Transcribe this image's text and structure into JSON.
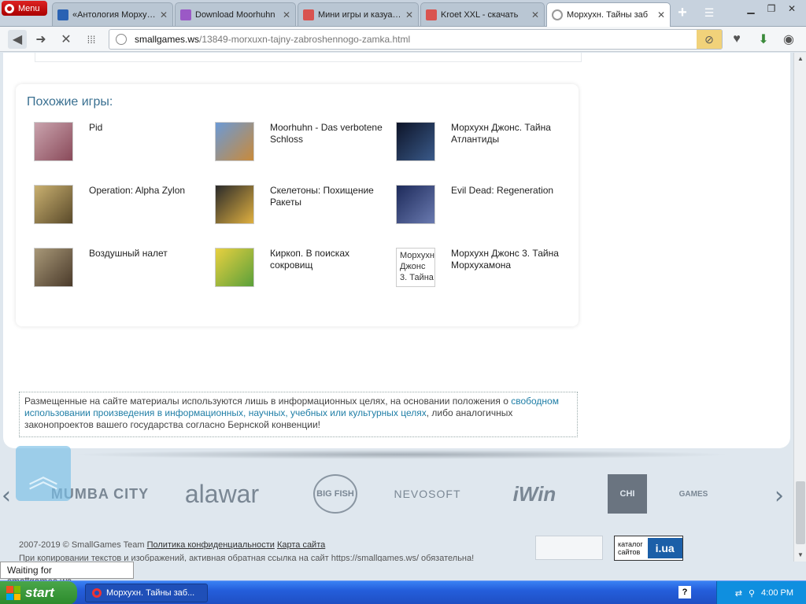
{
  "browser": {
    "menu_label": "Menu",
    "tabs": [
      {
        "title": "«Антология Морхухн»",
        "favicon_color": "#2a62b3"
      },
      {
        "title": "Download Moorhuhn",
        "favicon_color": "#9b59c6"
      },
      {
        "title": "Мини игры и казуаль",
        "favicon_color": "#d9534f"
      },
      {
        "title": "Kroet XXL - скачать",
        "favicon_color": "#d9534f"
      },
      {
        "title": "Морхухн. Тайны заб",
        "favicon_color": "#ffffff",
        "active": true
      }
    ],
    "url_domain": "smallgames.ws",
    "url_path": "/13849-morxuxn-tajny-zabroshennogo-zamka.html",
    "status_text": "Waiting for smallgames.ws..."
  },
  "similar_games": {
    "title": "Похожие игры:",
    "items": [
      {
        "name": "Pid",
        "thumb_color": "#8a4a5a"
      },
      {
        "name": "Moorhuhn - Das verbotene Schloss",
        "thumb_color": "#3c5f9a"
      },
      {
        "name": "Морхухн Джонс. Тайна Атлантиды",
        "thumb_color": "#1d2a4a"
      },
      {
        "name": "Operation: Alpha Zylon",
        "thumb_color": "#8a7440"
      },
      {
        "name": "Скелетоны: Похищение Ракеты",
        "thumb_color": "#3d8f3a"
      },
      {
        "name": "Evil Dead: Regeneration",
        "thumb_color": "#3a4a7a"
      },
      {
        "name": "Воздушный налет",
        "thumb_color": "#6a5a40"
      },
      {
        "name": "Киркоп. В поисках сокровищ",
        "thumb_color": "#7fbf3a"
      },
      {
        "name": "Морхухн Джонс 3. Тайна Морхухамона",
        "thumb_color": "#ffffff",
        "alt_text": "Морхухн Джонс 3. Тайна"
      }
    ]
  },
  "disclaimer": {
    "text_before": "Размещенные на сайте материалы используются лишь в информационных целях, на основании положения о ",
    "link_text": "свободном использовании произведения в информационных, научных, учебных или культурных целях",
    "text_after": ", либо аналогичных законопроектов вашего государства согласно Бернской конвенции!"
  },
  "partners": {
    "logos": [
      "MUMBA CITY",
      "alawar",
      "BIG FISH",
      "NEVOSOFT",
      "iWin",
      "CHI",
      "GAMES"
    ]
  },
  "footer": {
    "copyright": "2007-2019 © SmallGames Team",
    "privacy_link": "Политика конфиденциальности",
    "sitemap_link": "Карта сайта",
    "notice": "При копировании текстов и изображений, активная обратная ссылка на сайт https://smallgames.ws/ обязательна!",
    "catalog_label_1": "каталог",
    "catalog_label_2": "сайтов",
    "catalog_badge": "i.ua"
  },
  "taskbar": {
    "start_label": "start",
    "task_title": "Морхухн. Тайны заб...",
    "clock": "4:00 PM"
  }
}
